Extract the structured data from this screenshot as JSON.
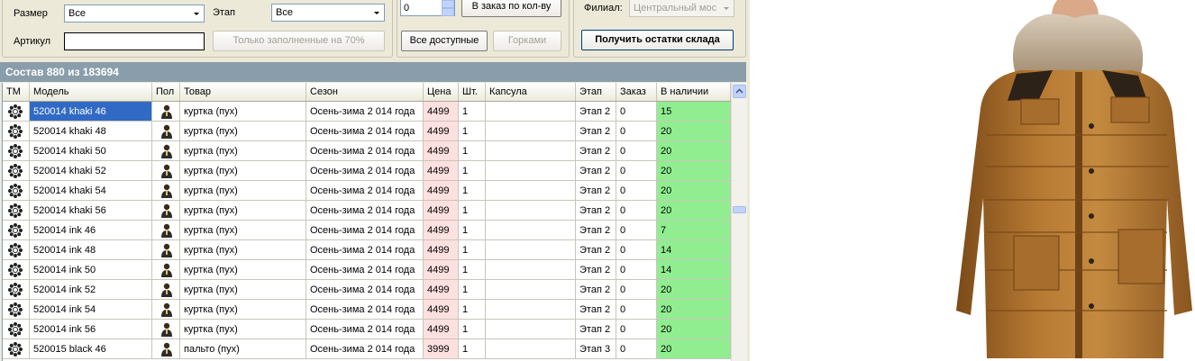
{
  "filters": {
    "size_label": "Размер",
    "size_value": "Все",
    "stage_label": "Этап",
    "stage_value": "Все",
    "article_label": "Артикул",
    "article_value": "",
    "filled_button": "Только заполненные на 70%"
  },
  "order": {
    "qty_value": "0",
    "order_by_qty_button": "В заказ по кол-ву",
    "all_available_button": "Все доступные",
    "slides_button": "Горками"
  },
  "branch": {
    "label": "Филиал:",
    "value": "Центральный мос",
    "get_stock_button": "Получить остатки склада"
  },
  "table": {
    "caption": "Состав 880 из 183694",
    "columns": [
      "ТМ",
      "Модель",
      "Пол",
      "Товар",
      "Сезон",
      "Цена",
      "Шт.",
      "Капсула",
      "Этап",
      "Заказ",
      "В наличии"
    ],
    "rows": [
      {
        "model": "520014 khaki  46",
        "product": "куртка (пух)",
        "season": "Осень-зима 2 014 года",
        "price": "4499",
        "qty": "1",
        "capsule": "",
        "stage": "Этап 2",
        "order": "0",
        "stock": "15"
      },
      {
        "model": "520014 khaki  48",
        "product": "куртка (пух)",
        "season": "Осень-зима 2 014 года",
        "price": "4499",
        "qty": "1",
        "capsule": "",
        "stage": "Этап 2",
        "order": "0",
        "stock": "20"
      },
      {
        "model": "520014 khaki  50",
        "product": "куртка (пух)",
        "season": "Осень-зима 2 014 года",
        "price": "4499",
        "qty": "1",
        "capsule": "",
        "stage": "Этап 2",
        "order": "0",
        "stock": "20"
      },
      {
        "model": "520014 khaki  52",
        "product": "куртка (пух)",
        "season": "Осень-зима 2 014 года",
        "price": "4499",
        "qty": "1",
        "capsule": "",
        "stage": "Этап 2",
        "order": "0",
        "stock": "20"
      },
      {
        "model": "520014 khaki  54",
        "product": "куртка (пух)",
        "season": "Осень-зима 2 014 года",
        "price": "4499",
        "qty": "1",
        "capsule": "",
        "stage": "Этап 2",
        "order": "0",
        "stock": "20"
      },
      {
        "model": "520014 khaki  56",
        "product": "куртка (пух)",
        "season": "Осень-зима 2 014 года",
        "price": "4499",
        "qty": "1",
        "capsule": "",
        "stage": "Этап 2",
        "order": "0",
        "stock": "20"
      },
      {
        "model": "520014 ink  46",
        "product": "куртка (пух)",
        "season": "Осень-зима 2 014 года",
        "price": "4499",
        "qty": "1",
        "capsule": "",
        "stage": "Этап 2",
        "order": "0",
        "stock": "7"
      },
      {
        "model": "520014 ink  48",
        "product": "куртка (пух)",
        "season": "Осень-зима 2 014 года",
        "price": "4499",
        "qty": "1",
        "capsule": "",
        "stage": "Этап 2",
        "order": "0",
        "stock": "14"
      },
      {
        "model": "520014 ink  50",
        "product": "куртка (пух)",
        "season": "Осень-зима 2 014 года",
        "price": "4499",
        "qty": "1",
        "capsule": "",
        "stage": "Этап 2",
        "order": "0",
        "stock": "14"
      },
      {
        "model": "520014 ink  52",
        "product": "куртка (пух)",
        "season": "Осень-зима 2 014 года",
        "price": "4499",
        "qty": "1",
        "capsule": "",
        "stage": "Этап 2",
        "order": "0",
        "stock": "20"
      },
      {
        "model": "520014 ink  54",
        "product": "куртка (пух)",
        "season": "Осень-зима 2 014 года",
        "price": "4499",
        "qty": "1",
        "capsule": "",
        "stage": "Этап 2",
        "order": "0",
        "stock": "20"
      },
      {
        "model": "520014 ink  56",
        "product": "куртка (пух)",
        "season": "Осень-зима 2 014 года",
        "price": "4499",
        "qty": "1",
        "capsule": "",
        "stage": "Этап 2",
        "order": "0",
        "stock": "20"
      },
      {
        "model": "520015 black  46",
        "product": "пальто (пух)",
        "season": "Осень-зима 2 014 года",
        "price": "3999",
        "qty": "1",
        "capsule": "",
        "stage": "Этап 3",
        "order": "0",
        "stock": "20"
      }
    ]
  },
  "icons": {
    "brand": "brand-logo-icon",
    "gender": "male-person-icon"
  },
  "colors": {
    "stock_bg": "#90ee90",
    "price_bg": "#fde0e0",
    "selection": "#316ac5",
    "caption_bg": "#8a9daa"
  }
}
